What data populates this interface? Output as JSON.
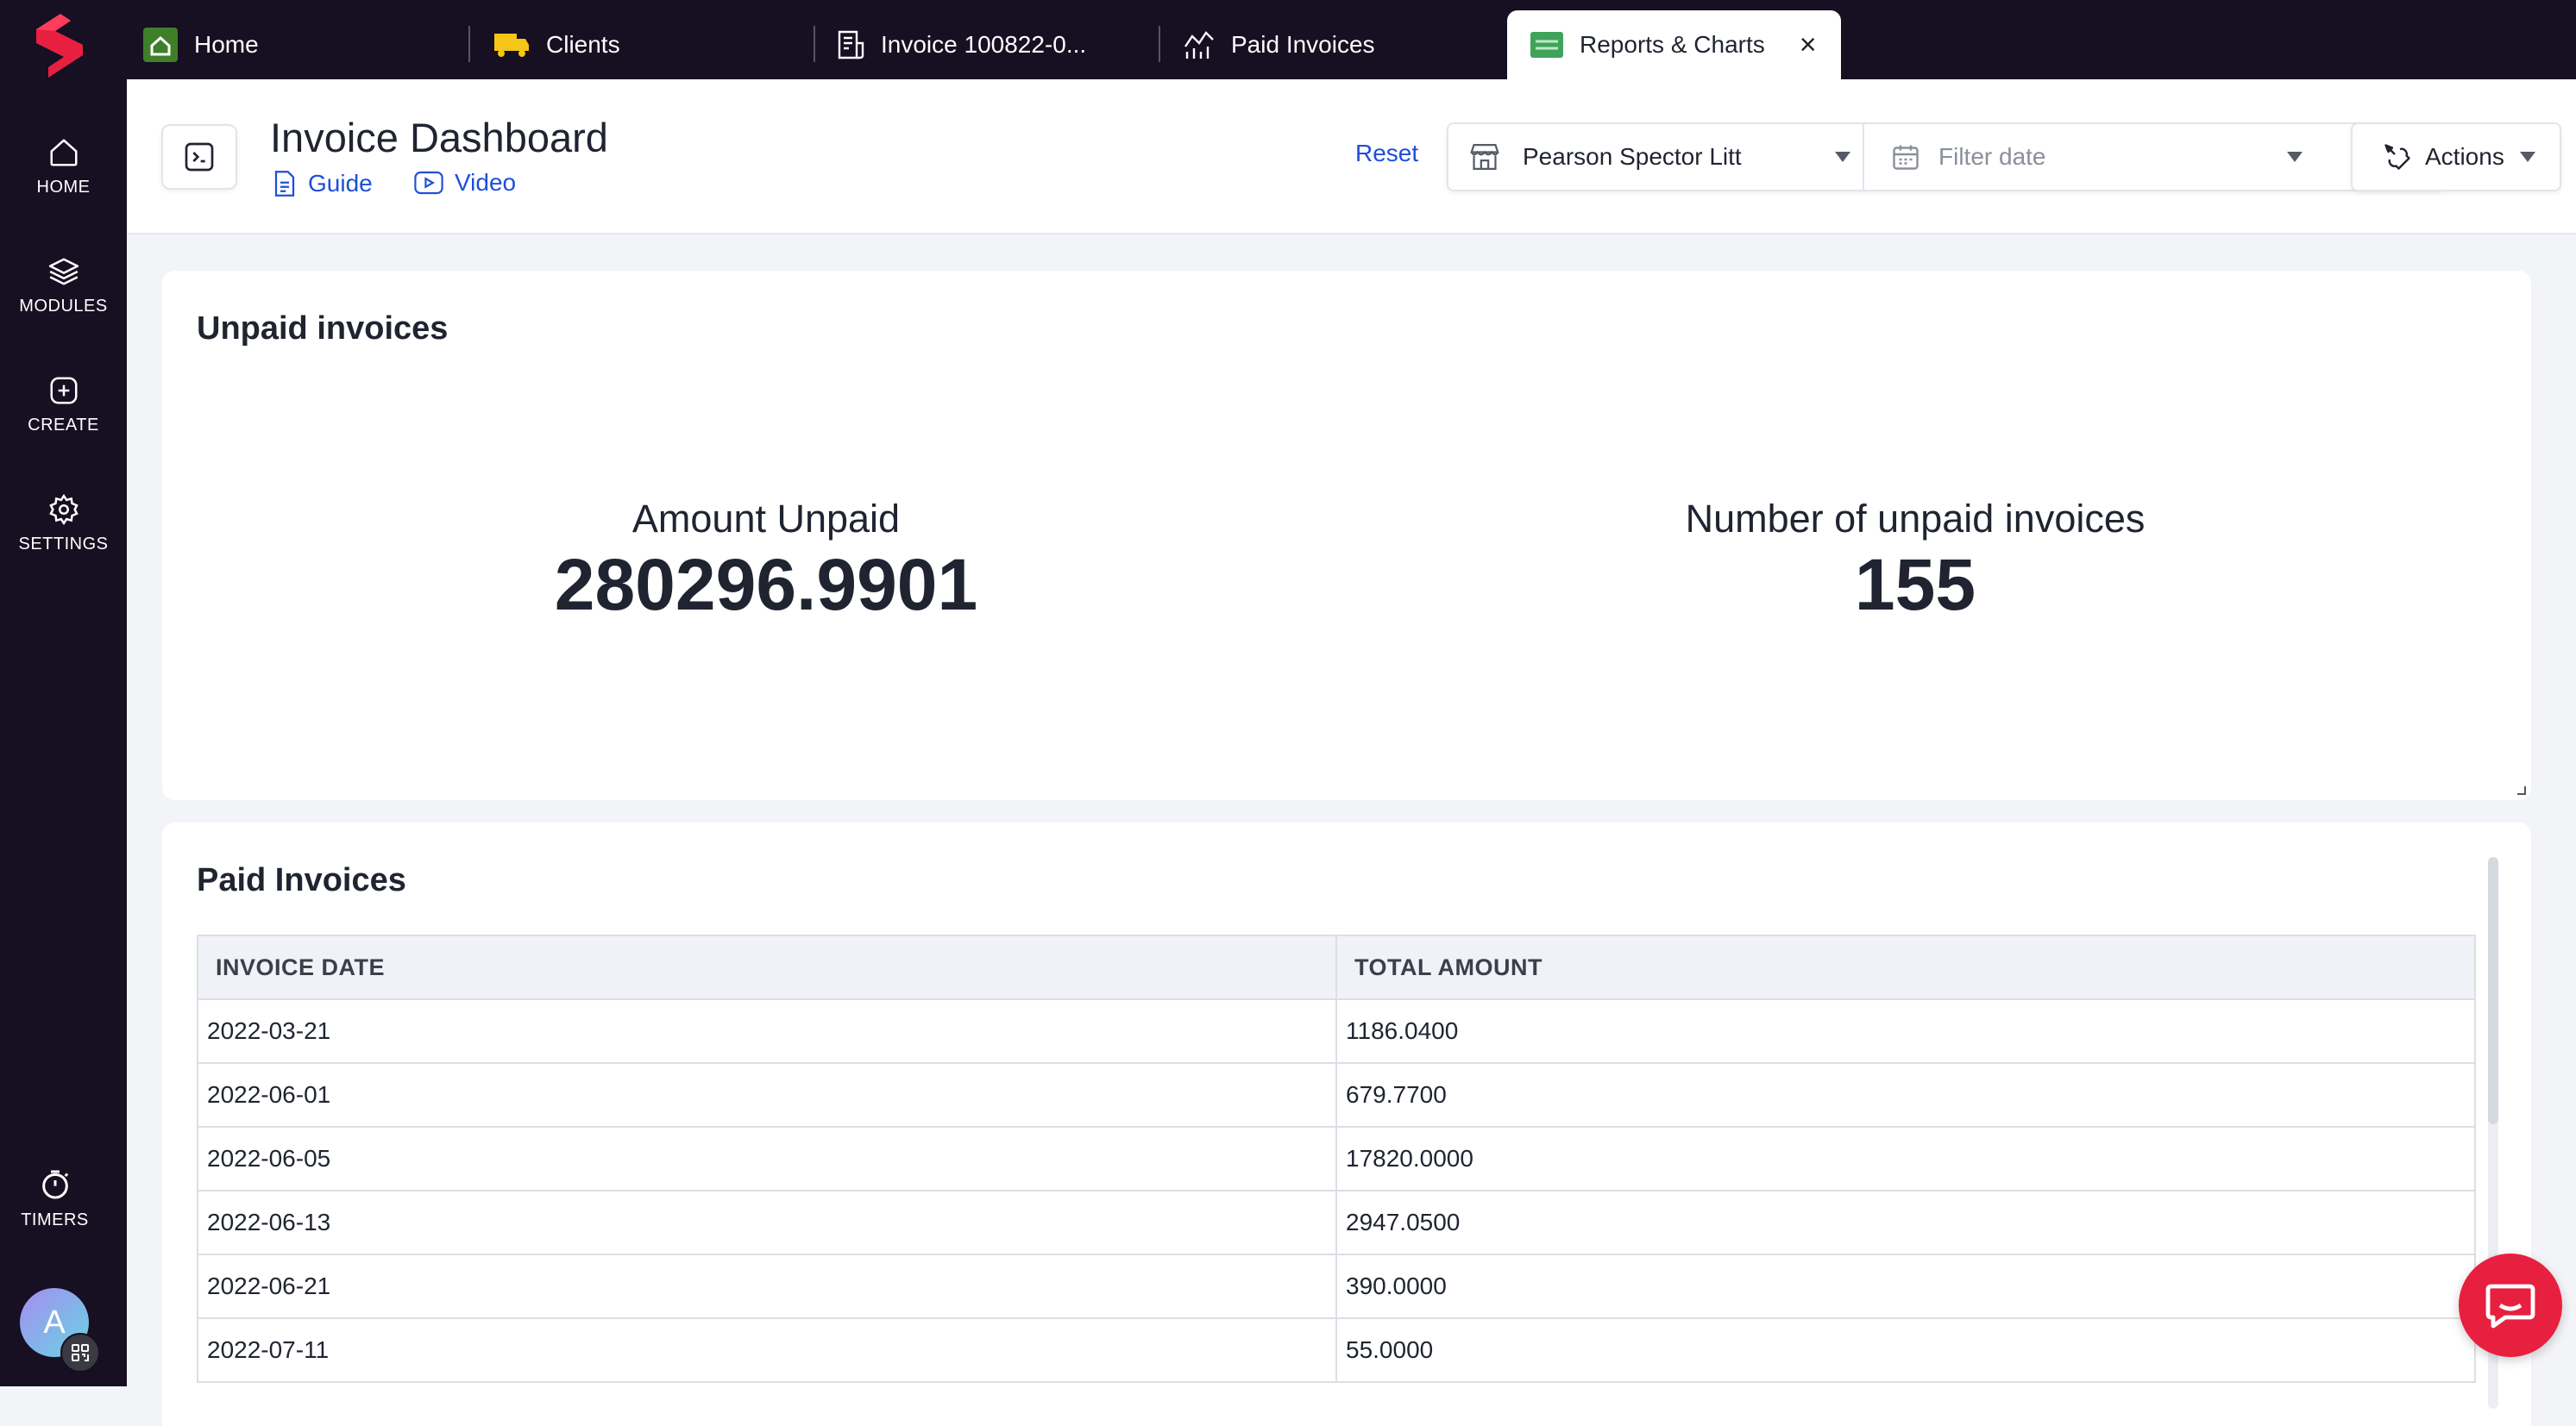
{
  "brand": {
    "accent": "#e8203f",
    "sidebar_bg": "#170f22",
    "link_color": "#1e4fd8"
  },
  "sidebar": {
    "items": [
      {
        "label": "HOME",
        "icon": "home-icon"
      },
      {
        "label": "MODULES",
        "icon": "layers-icon"
      },
      {
        "label": "CREATE",
        "icon": "plus-square-icon"
      },
      {
        "label": "SETTINGS",
        "icon": "gear-icon"
      }
    ],
    "timers": {
      "label": "TIMERS",
      "icon": "stopwatch-icon"
    },
    "avatar": {
      "initial": "A"
    }
  },
  "tabs": [
    {
      "label": "Home",
      "icon": "home-tile-icon"
    },
    {
      "label": "Clients",
      "icon": "truck-icon"
    },
    {
      "label": "Invoice 100822-0...",
      "icon": "invoice-icon"
    },
    {
      "label": "Paid Invoices",
      "icon": "chart-line-icon"
    },
    {
      "label": "Reports & Charts",
      "icon": "report-tile-icon",
      "active": true,
      "close": "×"
    }
  ],
  "header": {
    "title": "Invoice Dashboard",
    "guide_label": "Guide",
    "video_label": "Video",
    "reset_label": "Reset",
    "company_filter": "Pearson Spector Litt",
    "date_placeholder": "Filter date",
    "actions_label": "Actions"
  },
  "unpaid_card": {
    "title": "Unpaid invoices",
    "amount_label": "Amount Unpaid",
    "amount_value": "280296.9901",
    "count_label": "Number of unpaid invoices",
    "count_value": "155"
  },
  "paid_card": {
    "title": "Paid Invoices",
    "columns": [
      "INVOICE DATE",
      "TOTAL AMOUNT"
    ],
    "rows": [
      [
        "2022-03-21",
        "1186.0400"
      ],
      [
        "2022-06-01",
        "679.7700"
      ],
      [
        "2022-06-05",
        "17820.0000"
      ],
      [
        "2022-06-13",
        "2947.0500"
      ],
      [
        "2022-06-21",
        "390.0000"
      ],
      [
        "2022-07-11",
        "55.0000"
      ]
    ]
  }
}
